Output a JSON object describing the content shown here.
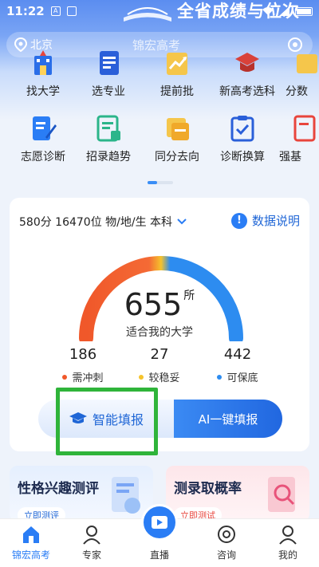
{
  "status": {
    "time": "11:22"
  },
  "header": {
    "banner": "全省成绩与位次",
    "city": "北京",
    "brand": "锦宏高考"
  },
  "menu": [
    {
      "label": "找大学",
      "icon": "university-icon"
    },
    {
      "label": "选专业",
      "icon": "book-list-icon"
    },
    {
      "label": "提前批",
      "icon": "early-batch-icon"
    },
    {
      "label": "新高考选科",
      "icon": "grad-cap-icon"
    },
    {
      "label": "分数",
      "icon": "score-icon"
    },
    {
      "label": "志愿诊断",
      "icon": "edit-doc-icon"
    },
    {
      "label": "招录趋势",
      "icon": "trend-doc-icon"
    },
    {
      "label": "同分去向",
      "icon": "same-score-icon"
    },
    {
      "label": "诊断换算",
      "icon": "clipboard-check-icon"
    },
    {
      "label": "强基",
      "icon": "strong-base-icon"
    }
  ],
  "score": {
    "info": "580分 16470位 物/地/生 本科",
    "data_link": "数据说明",
    "total": "655",
    "unit": "所",
    "subtitle": "适合我的大学",
    "stats": [
      {
        "value": "186",
        "label": "需冲刺",
        "color": "#f0582a"
      },
      {
        "value": "27",
        "label": "较稳妥",
        "color": "#f5c32c"
      },
      {
        "value": "442",
        "label": "可保底",
        "color": "#2d8cf0"
      }
    ],
    "btn_smart": "智能填报",
    "btn_ai": "AI一键填报"
  },
  "promo": {
    "left": {
      "title": "性格兴趣测评",
      "tag": "立即测评"
    },
    "right": {
      "title": "测录取概率",
      "tag": "立即测试"
    }
  },
  "tabbar": [
    {
      "label": "锦宏高考",
      "icon": "home-icon"
    },
    {
      "label": "专家",
      "icon": "expert-icon"
    },
    {
      "label": "直播",
      "icon": "live-icon"
    },
    {
      "label": "咨询",
      "icon": "consult-icon"
    },
    {
      "label": "我的",
      "icon": "profile-icon"
    }
  ],
  "colors": {
    "accent": "#2a7df5",
    "highlight": "#2fb43a"
  }
}
